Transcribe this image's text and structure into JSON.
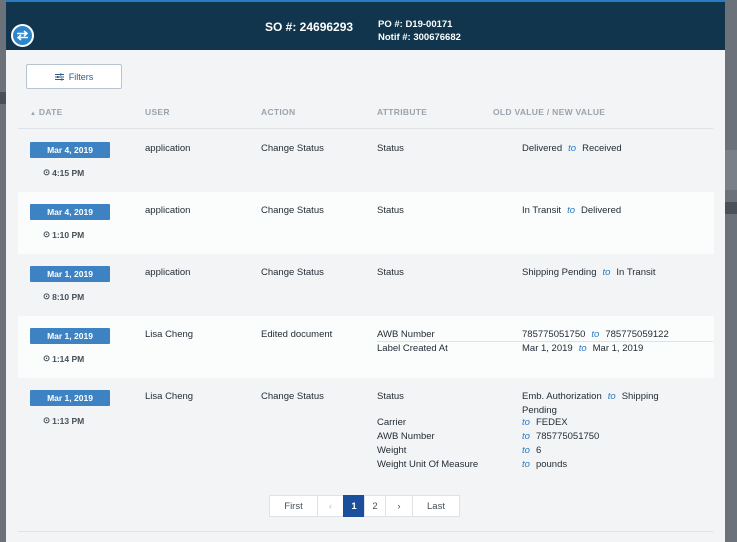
{
  "header": {
    "so_label": "SO #: 24696293",
    "po_label": "PO #: D19-00171",
    "notif_label": "Notif #: 300676682"
  },
  "toolbar": {
    "filters_label": "Filters"
  },
  "table": {
    "columns": [
      "DATE",
      "USER",
      "ACTION",
      "ATTRIBUTE",
      "OLD VALUE / NEW VALUE"
    ],
    "rows": [
      {
        "date": "Mar 4, 2019",
        "time": "4:15 PM",
        "user": "application",
        "action": "Change Status",
        "changes": [
          {
            "attribute": "Status",
            "old": "Delivered",
            "to": "to",
            "new": "Received"
          }
        ]
      },
      {
        "date": "Mar 4, 2019",
        "time": "1:10 PM",
        "user": "application",
        "action": "Change Status",
        "changes": [
          {
            "attribute": "Status",
            "old": "In Transit",
            "to": "to",
            "new": "Delivered"
          }
        ]
      },
      {
        "date": "Mar 1, 2019",
        "time": "8:10 PM",
        "user": "application",
        "action": "Change Status",
        "changes": [
          {
            "attribute": "Status",
            "old": "Shipping Pending",
            "to": "to",
            "new": "In Transit"
          }
        ]
      },
      {
        "date": "Mar 1, 2019",
        "time": "1:14 PM",
        "user": "Lisa Cheng",
        "action": "Edited document",
        "changes": [
          {
            "attribute": "AWB Number",
            "old": "785775051750",
            "to": "to",
            "new": "785775059122"
          },
          {
            "attribute": "Label Created At",
            "old": "Mar 1, 2019",
            "to": "to",
            "new": "Mar 1, 2019"
          }
        ]
      },
      {
        "date": "Mar 1, 2019",
        "time": "1:13 PM",
        "user": "Lisa Cheng",
        "action": "Change Status",
        "changes": [
          {
            "attribute": "Status",
            "old": "Emb. Authorization",
            "to": "to",
            "new": "Shipping",
            "new_cont": "Pending"
          },
          {
            "attribute": "Carrier",
            "old": "",
            "to": "to",
            "new": "FEDEX"
          },
          {
            "attribute": "AWB Number",
            "old": "",
            "to": "to",
            "new": "785775051750"
          },
          {
            "attribute": "Weight",
            "old": "",
            "to": "to",
            "new": "6"
          },
          {
            "attribute": "Weight Unit Of Measure",
            "old": "",
            "to": "to",
            "new": "pounds"
          }
        ]
      }
    ]
  },
  "pagination": {
    "first": "First",
    "prev": "‹",
    "pages": [
      "1",
      "2"
    ],
    "next": "›",
    "last": "Last",
    "current": "1"
  },
  "icons": {
    "swap": "swap-arrows-icon",
    "filter": "sliders-icon",
    "clock": "clock-icon",
    "sort": "sort-up-icon"
  },
  "colors": {
    "header_bg": "#10354c",
    "accent": "#2a7bc0",
    "badge": "#3d83c3",
    "active_page": "#1b4f9c"
  }
}
